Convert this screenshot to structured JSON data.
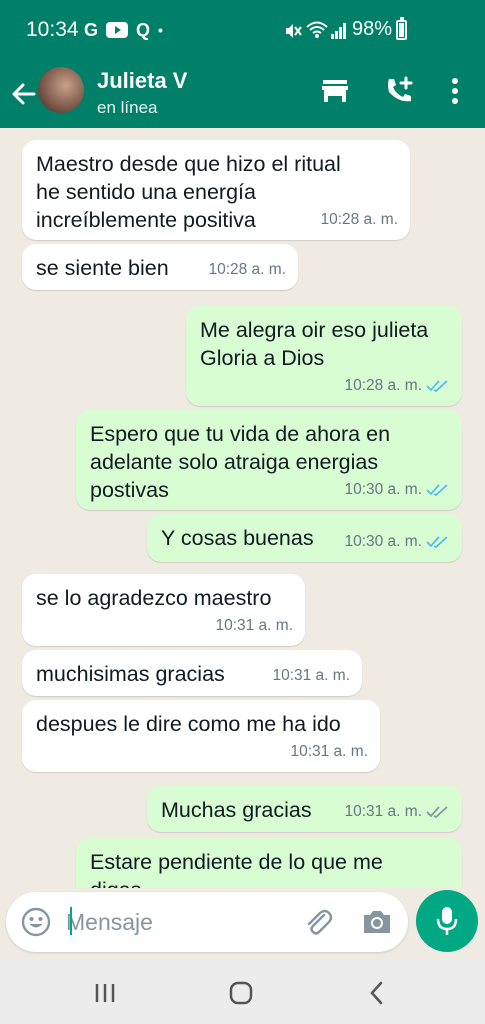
{
  "status_bar": {
    "time": "10:34",
    "left_icons": [
      "G",
      "youtube-icon",
      "Q",
      "•"
    ],
    "battery": "98%"
  },
  "header": {
    "contact_name": "Julieta V",
    "contact_status": "en línea",
    "icons": [
      "back-arrow-icon",
      "store-icon",
      "add-call-icon",
      "more-vert-icon"
    ]
  },
  "messages": [
    {
      "direction": "in",
      "text": "Maestro desde que hizo el ritual he sentido una energía increíblemente positiva",
      "time": "10:28 a. m."
    },
    {
      "direction": "in",
      "text": "se siente bien",
      "time": "10:28 a. m."
    },
    {
      "direction": "out",
      "text": "Me alegra oir eso julieta Gloria a Dios",
      "time": "10:28 a. m.",
      "status": "read"
    },
    {
      "direction": "out",
      "text": "Espero que tu vida de ahora en adelante solo atraiga energias postivas",
      "time": "10:30 a. m.",
      "status": "read"
    },
    {
      "direction": "out",
      "text": "Y cosas buenas",
      "time": "10:30 a. m.",
      "status": "read"
    },
    {
      "direction": "in",
      "text": "se lo agradezco maestro",
      "time": "10:31 a. m."
    },
    {
      "direction": "in",
      "text": "muchisimas gracias",
      "time": "10:31 a. m."
    },
    {
      "direction": "in",
      "text": "despues le dire como me ha ido",
      "time": "10:31 a. m."
    },
    {
      "direction": "out",
      "text": "Muchas gracias",
      "time": "10:31 a. m.",
      "status": "delivered"
    },
    {
      "direction": "out",
      "text": "Estare pendiente de lo que me digas",
      "time": "",
      "status": ""
    }
  ],
  "composer": {
    "placeholder": "Mensaje"
  },
  "colors": {
    "header": "#008069",
    "accent": "#00a884",
    "outgoing_bubble": "#d9fdd3",
    "incoming_bubble": "#ffffff",
    "chat_background": "#efeae2",
    "read_ticks": "#53bdeb",
    "delivered_ticks": "#8696a0"
  }
}
